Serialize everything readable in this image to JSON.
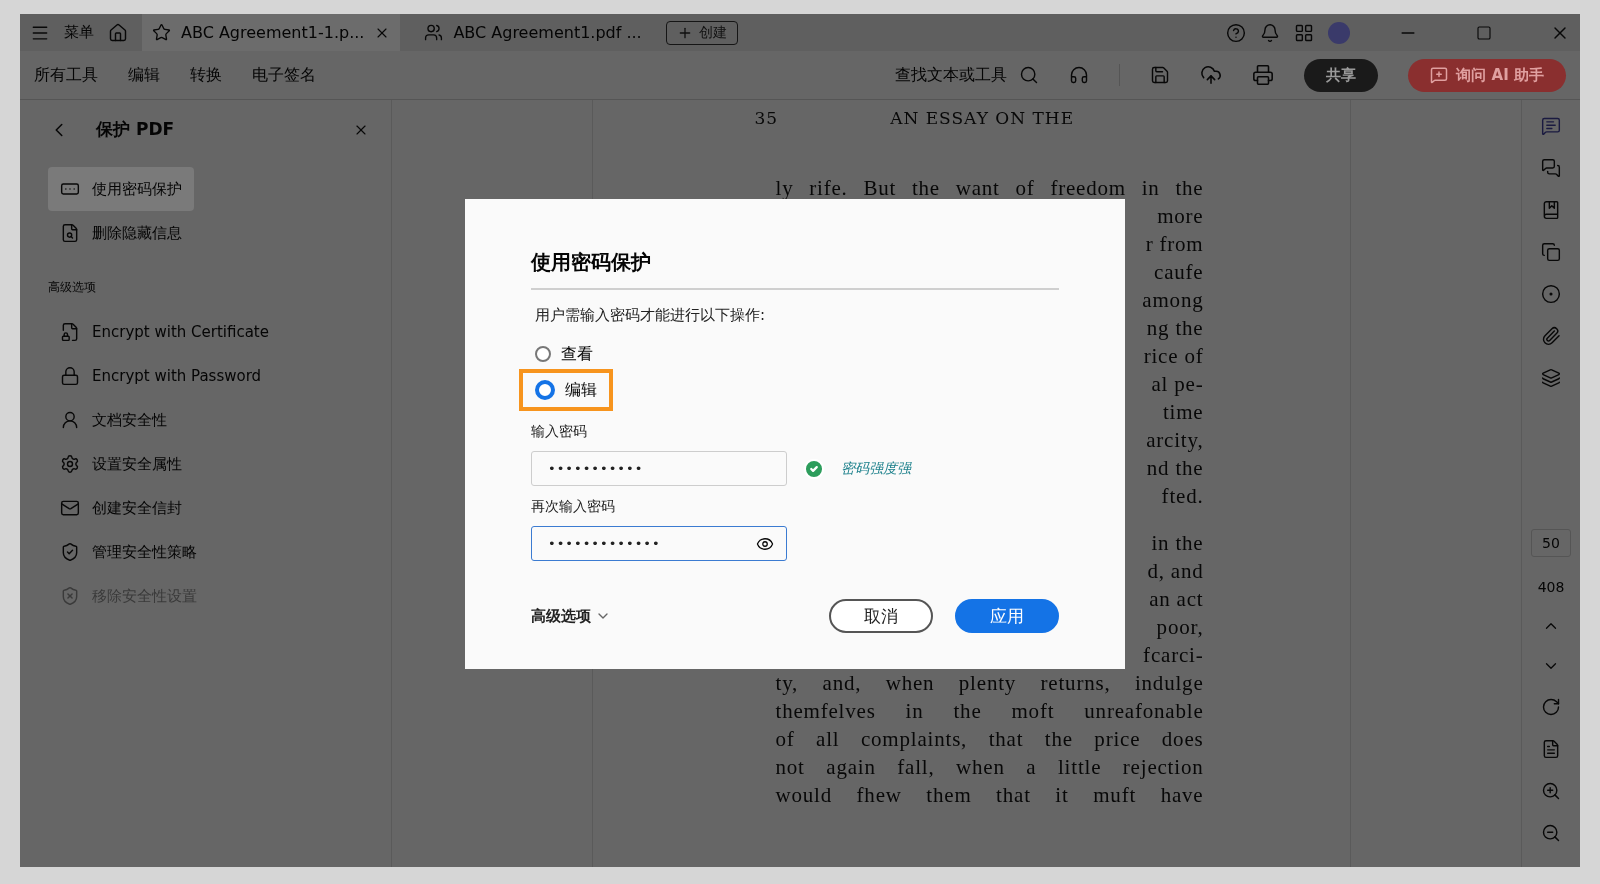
{
  "title_bar": {
    "menu": "菜单",
    "tabs": [
      {
        "title": "ABC Agreement1-1.p...",
        "kind": "starred",
        "selected": true
      },
      {
        "title": "ABC Agreement1.pdf ...",
        "kind": "shared",
        "selected": false
      }
    ],
    "create": "创建"
  },
  "toolbar": {
    "menus": [
      "所有工具",
      "编辑",
      "转换",
      "电子签名"
    ],
    "search": "查找文本或工具",
    "share": "共享",
    "ai_assistant": "询问 AI 助手"
  },
  "side_panel": {
    "title": "保护 PDF",
    "items": [
      {
        "label": "使用密码保护",
        "selected": true,
        "disabled": false
      },
      {
        "label": "删除隐藏信息",
        "selected": false,
        "disabled": false
      }
    ],
    "section": "高级选项",
    "advanced_items": [
      {
        "label": "Encrypt with Certificate",
        "selected": false,
        "disabled": false
      },
      {
        "label": "Encrypt with Password",
        "selected": false,
        "disabled": false
      },
      {
        "label": "文档安全性",
        "selected": false,
        "disabled": false
      },
      {
        "label": "设置安全属性",
        "selected": false,
        "disabled": false
      },
      {
        "label": "创建安全信封",
        "selected": false,
        "disabled": false
      },
      {
        "label": "管理安全性策略",
        "selected": false,
        "disabled": false
      },
      {
        "label": "移除安全性设置",
        "selected": false,
        "disabled": true
      }
    ]
  },
  "document": {
    "page_number": "35",
    "running_head": "AN ESSAY ON THE",
    "lines": [
      {
        "text": "ly rife. But the want of freedom in the",
        "kind": "full"
      },
      {
        "text": "more",
        "kind": "fragment"
      },
      {
        "text": "r from",
        "kind": "fragment"
      },
      {
        "text": "caufe",
        "kind": "fragment"
      },
      {
        "text": "among",
        "kind": "fragment"
      },
      {
        "text": "ng the",
        "kind": "fragment"
      },
      {
        "text": "rice of",
        "kind": "fragment"
      },
      {
        "text": "al pe-",
        "kind": "fragment"
      },
      {
        "text": "time",
        "kind": "fragment"
      },
      {
        "text": "arcity,",
        "kind": "fragment"
      },
      {
        "text": "nd the",
        "kind": "fragment"
      },
      {
        "text": "fted.",
        "kind": "fragment"
      },
      {
        "text": "in the",
        "kind": "fragment_break"
      },
      {
        "text": "d, and",
        "kind": "fragment"
      },
      {
        "text": "an act",
        "kind": "fragment"
      },
      {
        "text": "poor,",
        "kind": "fragment"
      },
      {
        "text": "fcarci-",
        "kind": "fragment"
      },
      {
        "text": "ty, and, when plenty returns, indulge",
        "kind": "full"
      },
      {
        "text": "themfelves in the moft unreafonable",
        "kind": "full"
      },
      {
        "text": "of all complaints, that the price does",
        "kind": "full"
      },
      {
        "text": "not again fall, when a little rejection",
        "kind": "full"
      },
      {
        "text": "would fhew them that it muft have",
        "kind": "full"
      }
    ]
  },
  "right_rail": {
    "page_input": "50",
    "page_total": "408"
  },
  "dialog": {
    "title": "使用密码保护",
    "prompt": "用户需输入密码才能进行以下操作:",
    "options": [
      {
        "label": "查看",
        "selected": false,
        "highlighted": false
      },
      {
        "label": "编辑",
        "selected": true,
        "highlighted": true
      }
    ],
    "fields": [
      {
        "label": "输入密码",
        "value": "•••••••••••",
        "focused": false
      },
      {
        "label": "再次输入密码",
        "value": "•••••••••••••",
        "focused": true
      }
    ],
    "strength": "密码强度强",
    "advanced": "高级选项",
    "cancel": "取消",
    "apply": "应用"
  }
}
